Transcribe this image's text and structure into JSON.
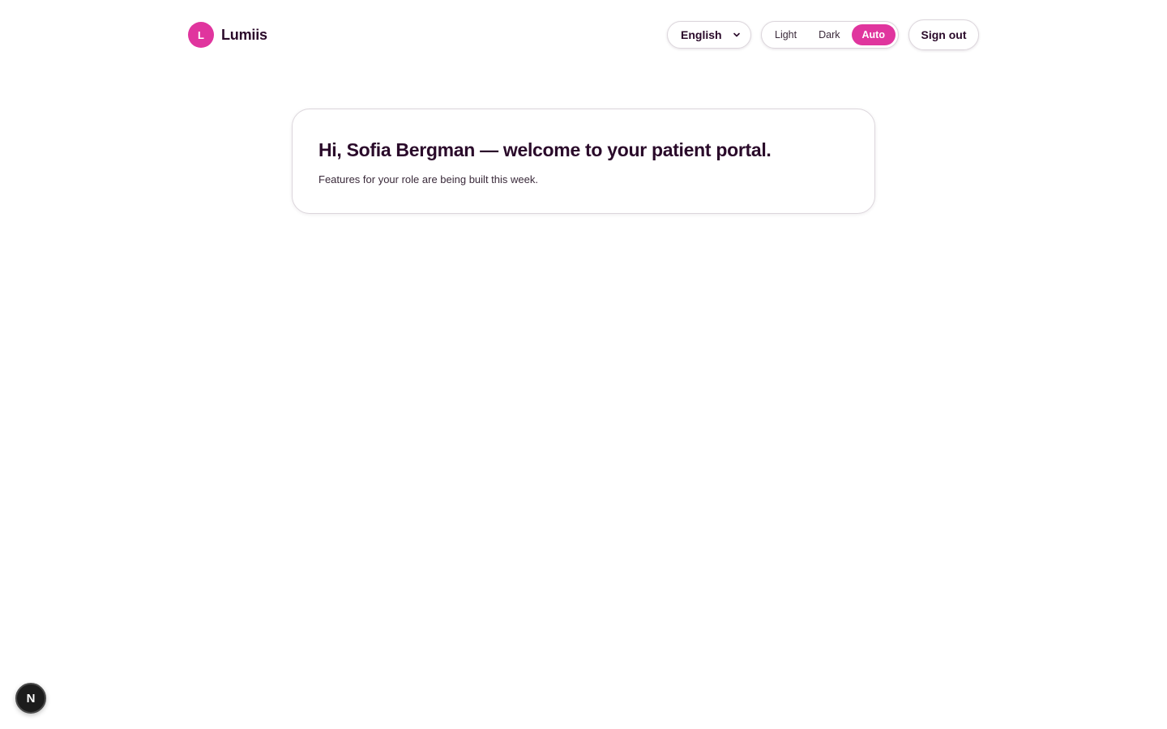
{
  "brand": {
    "mark_letter": "L",
    "name": "Lumiis",
    "accent_color": "#e0359e"
  },
  "header": {
    "language": {
      "selected": "English",
      "icon": "chevron-down-icon"
    },
    "theme": {
      "options": [
        "Light",
        "Dark",
        "Auto"
      ],
      "selected": "Auto"
    },
    "signout_label": "Sign out"
  },
  "main": {
    "title": "Hi, Sofia Bergman — welcome to your patient portal.",
    "subtitle": "Features for your role are being built this week."
  },
  "dev_badge": {
    "letter": "N",
    "icon": "nextjs-icon"
  }
}
